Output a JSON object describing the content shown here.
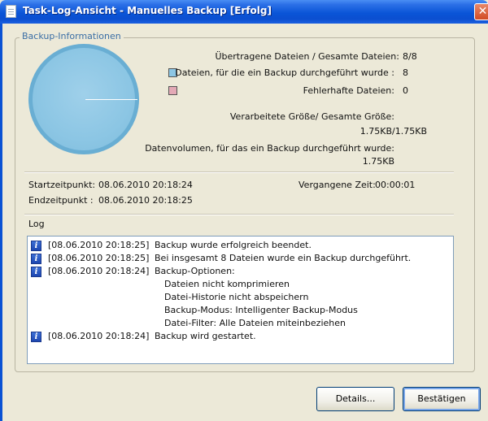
{
  "window": {
    "title": "Task-Log-Ansicht - Manuelles Backup [Erfolg]",
    "close_glyph": "✕"
  },
  "backup_info": {
    "legend": "Backup-Informationen",
    "transferred_label": "Übertragene Dateien / Gesamte Dateien:",
    "transferred_value": "8/8",
    "backed_up_files_label": "Dateien, für die ein Backup durchgeführt wurde :",
    "backed_up_files_value": "8",
    "failed_files_label": "Fehlerhafte Dateien:",
    "failed_files_value": "0",
    "processed_size_label": "Verarbeitete Größe/ Gesamte Größe:",
    "processed_size_value": "1.75KB/1.75KB",
    "backup_volume_label": "Datenvolumen, für das ein Backup durchgeführt wurde:",
    "backup_volume_value": "1.75KB",
    "colors": {
      "success": "#8cc6e4",
      "failed": "#e3a9b6"
    }
  },
  "times": {
    "start_label": "Startzeitpunkt:",
    "start_value": "08.06.2010 20:18:24",
    "end_label": "Endzeitpunkt :",
    "end_value": "08.06.2010 20:18:25",
    "elapsed_label": "Vergangene Zeit:",
    "elapsed_value": "00:00:01"
  },
  "log": {
    "title": "Log",
    "entries": [
      {
        "icon": "info-icon",
        "timestamp": "[08.06.2010 20:18:25]",
        "message": "Backup wurde erfolgreich beendet."
      },
      {
        "icon": "info-icon",
        "timestamp": "[08.06.2010 20:18:25]",
        "message": "Bei insgesamt 8 Dateien wurde ein Backup durchgeführt."
      },
      {
        "icon": "info-icon",
        "timestamp": "[08.06.2010 20:18:24]",
        "message": "Backup-Optionen:"
      },
      {
        "timestamp": "",
        "message": "Dateien nicht komprimieren"
      },
      {
        "timestamp": "",
        "message": "Datei-Historie nicht abspeichern"
      },
      {
        "timestamp": "",
        "message": "Backup-Modus: Intelligenter Backup-Modus"
      },
      {
        "timestamp": "",
        "message": "Datei-Filter: Alle Dateien miteinbeziehen"
      },
      {
        "icon": "info-icon",
        "timestamp": "[08.06.2010 20:18:24]",
        "message": "Backup wird gestartet."
      }
    ]
  },
  "buttons": {
    "details": "Details...",
    "confirm": "Bestätigen"
  }
}
